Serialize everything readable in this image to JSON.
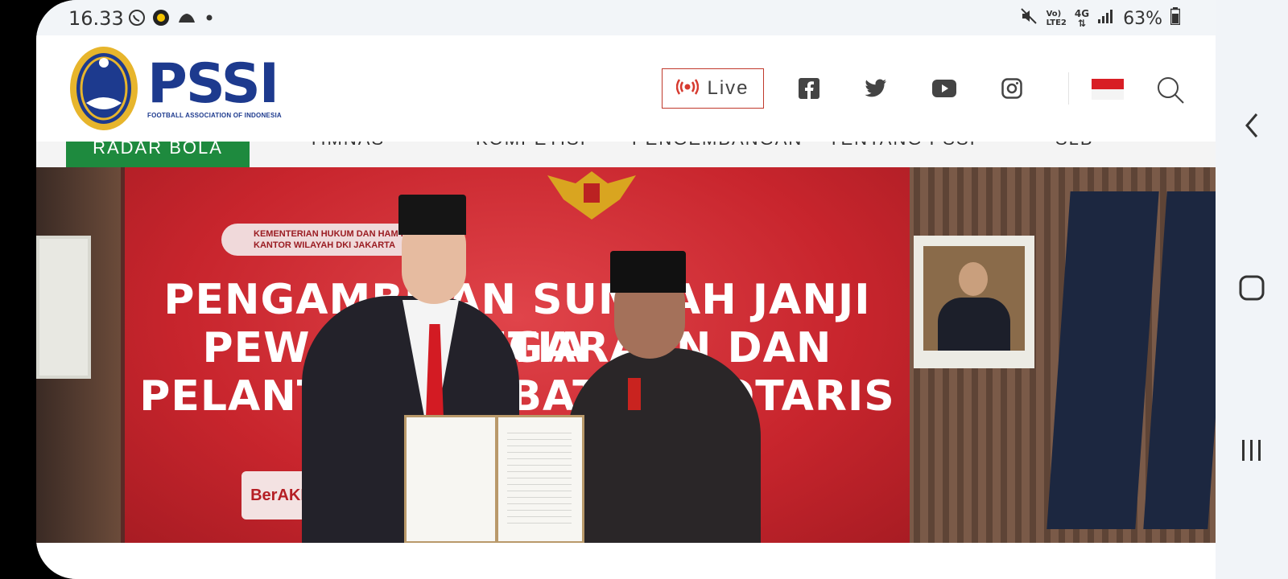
{
  "status_bar": {
    "time": "16.33",
    "left_icons": [
      "whatsapp-icon",
      "app-notification-icon",
      "weather-icon",
      "dot-icon"
    ],
    "battery": "63%",
    "network_top": "Vo)",
    "network_bottom": "LTE2",
    "network_type": "4G"
  },
  "header": {
    "logo_text": "PSSI",
    "logo_subtitle": "FOOTBALL ASSOCIATION OF INDONESIA",
    "live_label": "Live",
    "social": [
      "facebook-icon",
      "twitter-icon",
      "youtube-icon",
      "instagram-icon"
    ],
    "language_flag": "indonesia-flag"
  },
  "nav": {
    "items": [
      "RADAR BOLA",
      "TIMNAS",
      "KOMPETISI",
      "PENGEMBANGAN",
      "TENTANG PSSI",
      "SLB"
    ],
    "active_index": 0
  },
  "hero": {
    "banner_small_text_1": "KEMENTERIAN HUKUM DAN HAM RI",
    "banner_small_text_2": "KANTOR WILAYAH DKI JAKARTA",
    "banner_line_1": "PENGAMBILAN SUMPAH JANJI SETIA",
    "banner_line_2": "PEWARGANEGARAAN DAN",
    "banner_line_3": "PELANTIKAN JABATAN NOTARIS",
    "banner_footer": "BerAKHLAK"
  },
  "colors": {
    "brand_blue": "#1d3a8e",
    "nav_active": "#1e8a3e",
    "live_red": "#c0392b",
    "banner_red": "#c8252d"
  },
  "system_nav": [
    "back-icon",
    "home-icon",
    "recent-apps-icon"
  ]
}
